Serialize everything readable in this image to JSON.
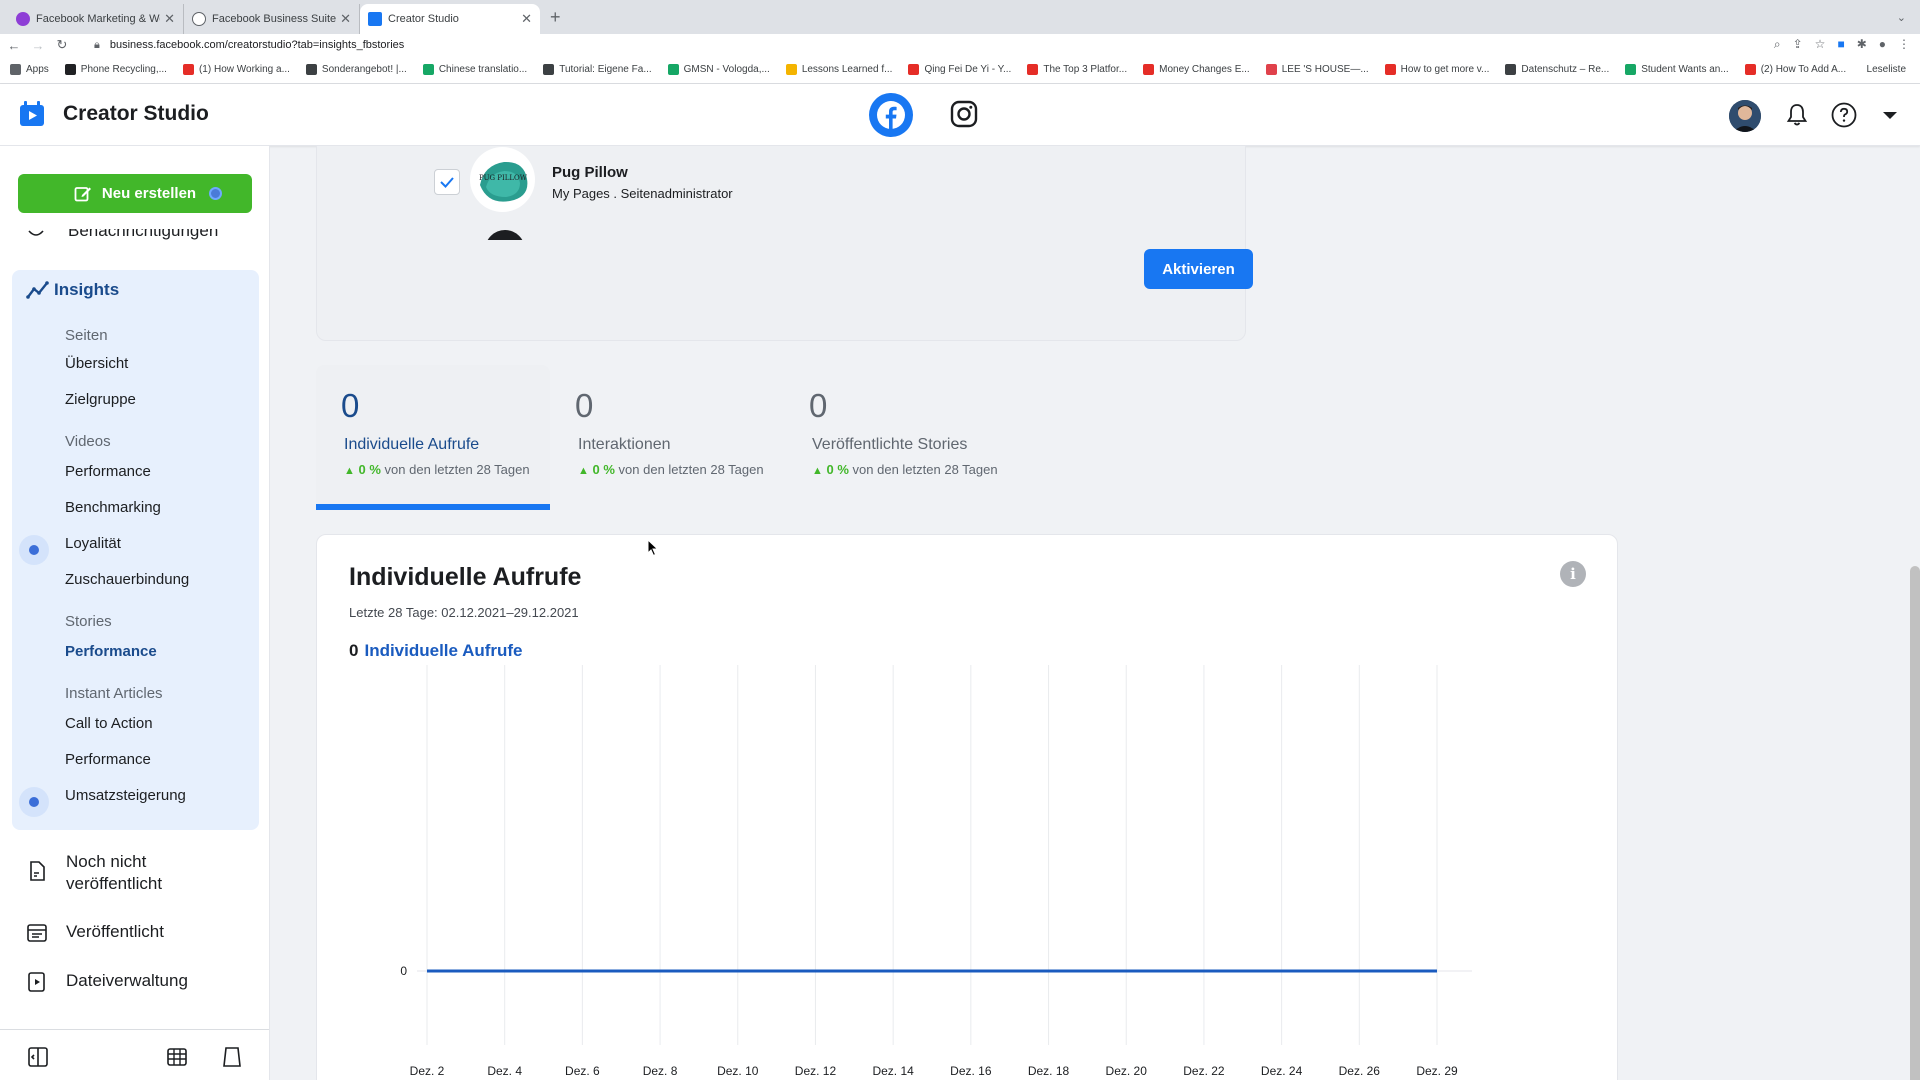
{
  "browser": {
    "tabs": [
      {
        "title": "Facebook Marketing & Werbea...",
        "fav_color": "#8e3ed6"
      },
      {
        "title": "Facebook Business Suite",
        "fav_color": "#5f6368"
      },
      {
        "title": "Creator Studio",
        "fav_color": "#1877f2"
      }
    ],
    "new_tab": "+",
    "url": "business.facebook.com/creatorstudio?tab=insights_fbstories",
    "bookmarks": [
      {
        "label": "Apps",
        "color": "#5f6368"
      },
      {
        "label": "Phone Recycling,...",
        "color": "#202124"
      },
      {
        "label": "(1) How Working a...",
        "color": "#e52d27"
      },
      {
        "label": "Sonderangebot! |...",
        "color": "#3c4043"
      },
      {
        "label": "Chinese translatio...",
        "color": "#16a765"
      },
      {
        "label": "Tutorial: Eigene Fa...",
        "color": "#3c4043"
      },
      {
        "label": "GMSN - Vologda,...",
        "color": "#16a765"
      },
      {
        "label": "Lessons Learned f...",
        "color": "#f4b400"
      },
      {
        "label": "Qing Fei De Yi - Y...",
        "color": "#e52d27"
      },
      {
        "label": "The Top 3 Platfor...",
        "color": "#e52d27"
      },
      {
        "label": "Money Changes E...",
        "color": "#e52d27"
      },
      {
        "label": "LEE 'S HOUSE—...",
        "color": "#e0414b"
      },
      {
        "label": "How to get more v...",
        "color": "#e52d27"
      },
      {
        "label": "Datenschutz – Re...",
        "color": "#3c4043"
      },
      {
        "label": "Student Wants an...",
        "color": "#16a765"
      },
      {
        "label": "(2) How To Add A...",
        "color": "#e52d27"
      }
    ],
    "reading_list": "Leseliste"
  },
  "header": {
    "brand": "Creator Studio"
  },
  "sidebar": {
    "create_label": "Neu erstellen",
    "cut_item": "Benachrichtigungen",
    "insights_label": "Insights",
    "sections": [
      {
        "label": "Seiten",
        "items": [
          "Übersicht",
          "Zielgruppe"
        ]
      },
      {
        "label": "Videos",
        "items": [
          "Performance",
          "Benchmarking",
          "Loyalität",
          "Zuschauerbindung"
        ]
      },
      {
        "label": "Stories",
        "items": [
          "Performance"
        ]
      },
      {
        "label": "Instant Articles",
        "items": [
          "Call to Action",
          "Performance",
          "Umsatzsteigerung"
        ]
      }
    ],
    "nav": {
      "unpublished": "Noch nicht",
      "unpublished_2": "veröffentlicht",
      "published": "Veröffentlicht",
      "files": "Dateiverwaltung"
    }
  },
  "page_select": {
    "name": "Pug Pillow",
    "sub": "My Pages . Seitenadministrator",
    "logo_text": "PUG PILLOW",
    "activate_label": "Aktivieren"
  },
  "metrics": [
    {
      "value": "0",
      "label": "Individuelle Aufrufe",
      "change": "0 %",
      "change_suffix": "von den letzten 28 Tagen"
    },
    {
      "value": "0",
      "label": "Interaktionen",
      "change": "0 %",
      "change_suffix": "von den letzten 28 Tagen"
    },
    {
      "value": "0",
      "label": "Veröffentlichte Stories",
      "change": "0 %",
      "change_suffix": "von den letzten 28 Tagen"
    }
  ],
  "chart_card": {
    "title": "Individuelle Aufrufe",
    "range": "Letzte 28 Tage: 02.12.2021–29.12.2021",
    "count_value": "0",
    "count_label": "Individuelle Aufrufe",
    "info": "i"
  },
  "chart_data": {
    "type": "line",
    "x": [
      "Dez. 2",
      "Dez. 4",
      "Dez. 6",
      "Dez. 8",
      "Dez. 10",
      "Dez. 12",
      "Dez. 14",
      "Dez. 16",
      "Dez. 18",
      "Dez. 20",
      "Dez. 22",
      "Dez. 24",
      "Dez. 26",
      "Dez. 29"
    ],
    "series": [
      {
        "values": [
          0,
          0,
          0,
          0,
          0,
          0,
          0,
          0,
          0,
          0,
          0,
          0,
          0,
          0
        ],
        "color": "#1a5bbf"
      }
    ],
    "y_ticks": [
      "0"
    ],
    "grid": true
  },
  "colors": {
    "accent": "#1877f2",
    "create_green": "#42b72a",
    "insights_bg": "#e7f0fd",
    "active_text": "#1a4b8c"
  }
}
